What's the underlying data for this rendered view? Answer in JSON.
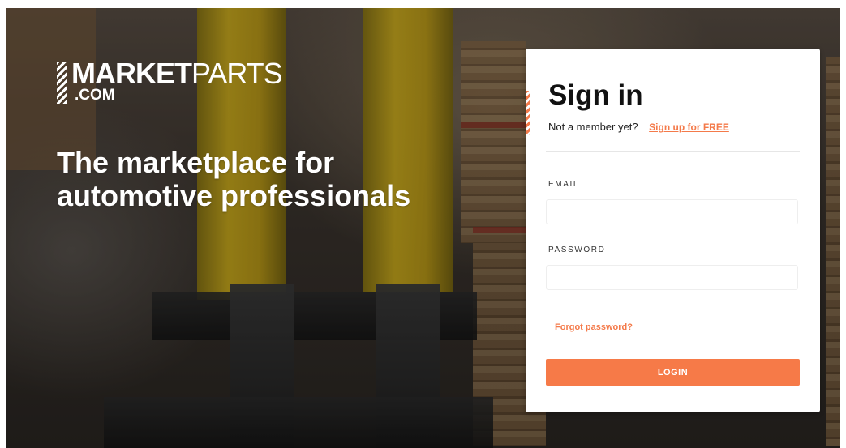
{
  "brand": {
    "logo_bold": "MARKET",
    "logo_light": "PARTS",
    "logo_suffix": ".COM"
  },
  "hero": {
    "headline_line1": "The marketplace for",
    "headline_line2": "automotive professionals"
  },
  "signin": {
    "title": "Sign in",
    "member_prompt": "Not a member yet?",
    "signup_link": "Sign up for FREE",
    "email_label": "EMAIL",
    "email_value": "",
    "password_label": "PASSWORD",
    "password_value": "",
    "forgot_link": "Forgot password?",
    "login_button": "LOGIN"
  },
  "colors": {
    "accent": "#f67a48",
    "link": "#f47a4a",
    "card_background": "#ffffff",
    "headline_text": "#ffffff"
  }
}
